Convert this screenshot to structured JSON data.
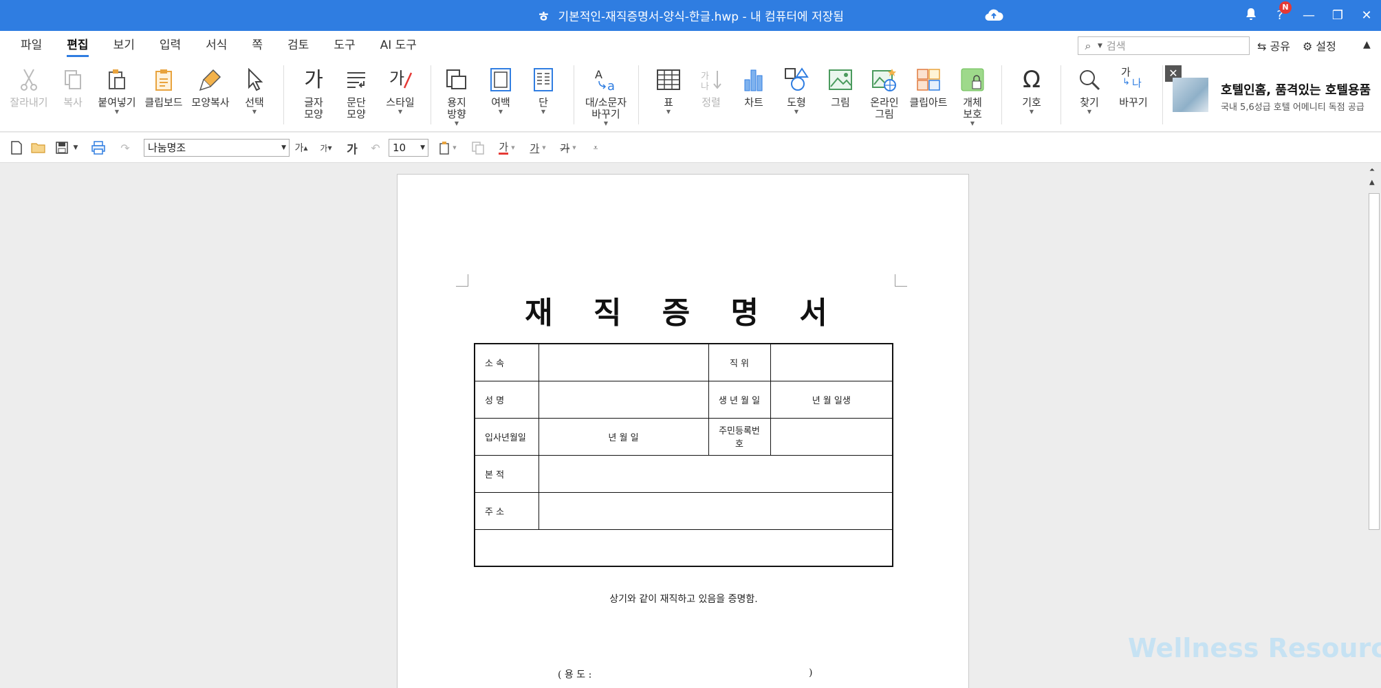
{
  "titlebar": {
    "title": "기본적인-재직증명서-양식-한글.hwp - 내 컴퓨터에 저장됨",
    "notif_badge": "N"
  },
  "menu": {
    "tabs": [
      "파일",
      "편집",
      "보기",
      "입력",
      "서식",
      "쪽",
      "검토",
      "도구",
      "AI 도구"
    ],
    "active_tab": "편집",
    "search_placeholder": "검색",
    "share": "공유",
    "settings": "설정"
  },
  "ribbon": {
    "cut": "잘라내기",
    "copy": "복사",
    "paste": "붙여넣기",
    "clipboard": "클립보드",
    "format_painter": "모양복사",
    "select": "선택",
    "char_shape_l1": "글자",
    "char_shape_l2": "모양",
    "para_shape_l1": "문단",
    "para_shape_l2": "모양",
    "style": "스타일",
    "orientation_l1": "용지",
    "orientation_l2": "방향",
    "margin": "여백",
    "columns": "단",
    "case_l1": "대/소문자",
    "case_l2": "바꾸기",
    "table": "표",
    "sort": "정렬",
    "chart": "차트",
    "shape": "도형",
    "picture": "그림",
    "online_pic_l1": "온라인",
    "online_pic_l2": "그림",
    "clipart": "클립아트",
    "protect_l1": "개체",
    "protect_l2": "보호",
    "symbol": "기호",
    "find": "찾기",
    "replace": "바꾸기",
    "char_glyph": "가",
    "replace_glyph_from": "가",
    "replace_glyph_to": "나"
  },
  "ad": {
    "headline": "호텔인홈, 품격있는 호텔용품",
    "sub": "국내 5,6성급 호텔 어메니티 독점 공급"
  },
  "toolbar": {
    "font_name": "나눔명조",
    "font_size": "10",
    "grow": "가",
    "shrink": "가",
    "bold": "가",
    "font_color": "가",
    "underline": "가",
    "strike": "가"
  },
  "document": {
    "title": "재 직 증 명 서",
    "rows": [
      {
        "label": "소      속",
        "value": "",
        "label2": "직      위",
        "value2": ""
      },
      {
        "label": "성      명",
        "value": "",
        "label2": "생 년 월 일",
        "value2": "년      월      일생"
      },
      {
        "label": "입사년월일",
        "value": "년      월      일",
        "label2": "주민등록번호",
        "value2": ""
      }
    ],
    "row_domicile": "본      적",
    "row_address": "주      소",
    "statement": "상기와 같이 재직하고 있음을 증명함.",
    "purpose_open": "( 용 도 :",
    "purpose_close": ")"
  },
  "watermark": "Wellness Resources",
  "colors": {
    "titlebar": "#2f7de1",
    "accent": "#2f7de1",
    "page_bg": "#ededed"
  }
}
